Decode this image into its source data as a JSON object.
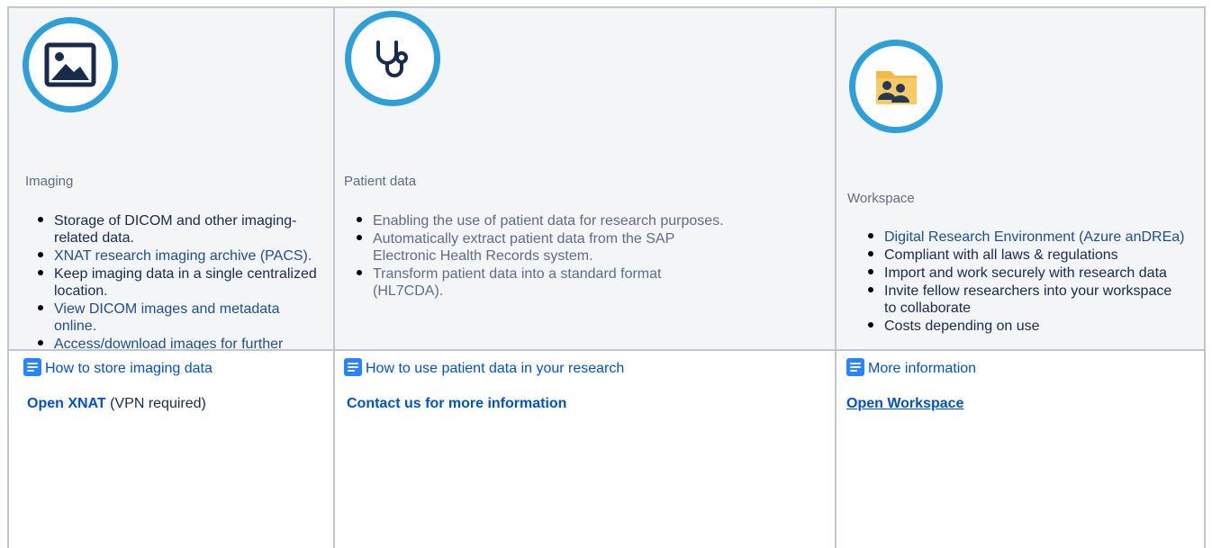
{
  "columns": [
    {
      "icon": "image-icon",
      "heading": "Imaging",
      "features": [
        {
          "text": "Storage of DICOM and other imaging-related data.",
          "style": "dark"
        },
        {
          "text": "XNAT research imaging archive (PACS).",
          "style": "link"
        },
        {
          "text": "Keep imaging data in a single centralized location.",
          "style": "dark"
        },
        {
          "text": "View DICOM images and metadata online.",
          "style": "link"
        },
        {
          "text": "Access/download images for further analysis.",
          "style": "link"
        }
      ],
      "doc_link": "How to store imaging data",
      "action": "Open XNAT",
      "action_note": " (VPN required)"
    },
    {
      "icon": "stethoscope-icon",
      "heading": "Patient data",
      "features": [
        {
          "text": "Enabling the use of patient data for research purposes.",
          "style": "dark"
        },
        {
          "text": "Automatically extract patient data from the SAP Electronic Health Records system.",
          "style": "dark"
        },
        {
          "text": "Transform patient data into a standard format (HL7CDA).",
          "style": "dark"
        }
      ],
      "doc_link": "How to use patient data in your research",
      "action": "Contact us for more information"
    },
    {
      "icon": "shared-folder-users-icon",
      "heading": "Workspace",
      "features": [
        {
          "text": "Digital Research Environment (Azure anDREa)",
          "style": "link"
        },
        {
          "text": "Compliant with all laws & regulations",
          "style": "dark"
        },
        {
          "text": "Import and work securely with research data",
          "style": "dark"
        },
        {
          "text": "Invite fellow researchers into your workspace to collaborate",
          "style": "dark"
        },
        {
          "text": "Costs depending on use",
          "style": "dark"
        }
      ],
      "doc_link": "More information",
      "action": "Open Workspace"
    }
  ],
  "colors": {
    "circle_border": "#2d9fd9",
    "link": "#0052cc",
    "doc_icon": "#2684ff",
    "cell_bg": "#f4f5f7",
    "border": "#c1c7d0"
  }
}
